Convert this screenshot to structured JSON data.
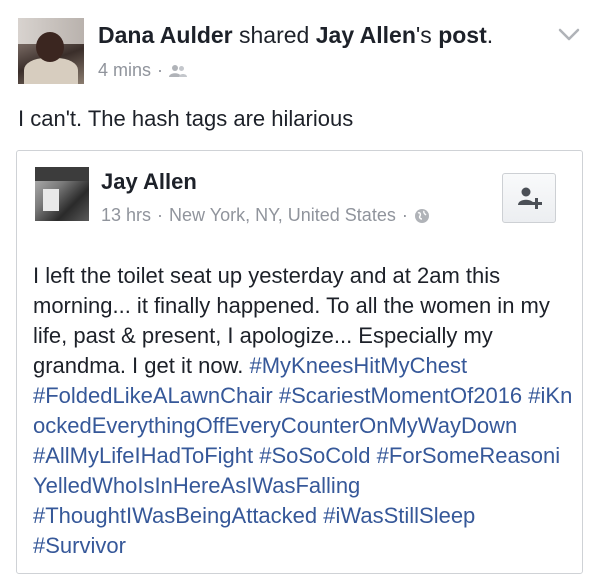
{
  "post": {
    "author": "Dana Aulder",
    "shared_word": "shared",
    "original_author_possessive": "Jay Allen",
    "possessive_suffix": "'s",
    "post_word": "post",
    "period": ".",
    "time": "4 mins",
    "separator": "·",
    "privacy_icon": "friends-icon",
    "text": "I can't. The hash tags are hilarious"
  },
  "shared_post": {
    "author": "Jay Allen",
    "time": "13 hrs",
    "separator": "·",
    "location": "New York, NY, United States",
    "separator2": "·",
    "privacy_icon": "globe-icon",
    "add_friend_icon": "add-friend-icon",
    "body_text": "I left the toilet seat up yesterday and at 2am this morning... it finally happened. To all the women in my life, past & present, I apologize... Especially my grandma. I get it now.",
    "hashtags": [
      "#MyKneesHitMyChest",
      "#FoldedLikeALawnChair",
      "#ScariestMomentOf2016",
      "#iKnockedEverythingOffEveryCounterOnMyWayDown",
      "#AllMyLifeIHadToFight",
      "#SoSoCold",
      "#ForSomeReasoniYelledWhoIsInHereAsIWasFalling",
      "#ThoughtIWasBeingAttacked",
      "#iWasStillSleep",
      "#Survivor"
    ]
  },
  "colors": {
    "link": "#365899",
    "meta": "#90949c",
    "text": "#1d2129"
  }
}
